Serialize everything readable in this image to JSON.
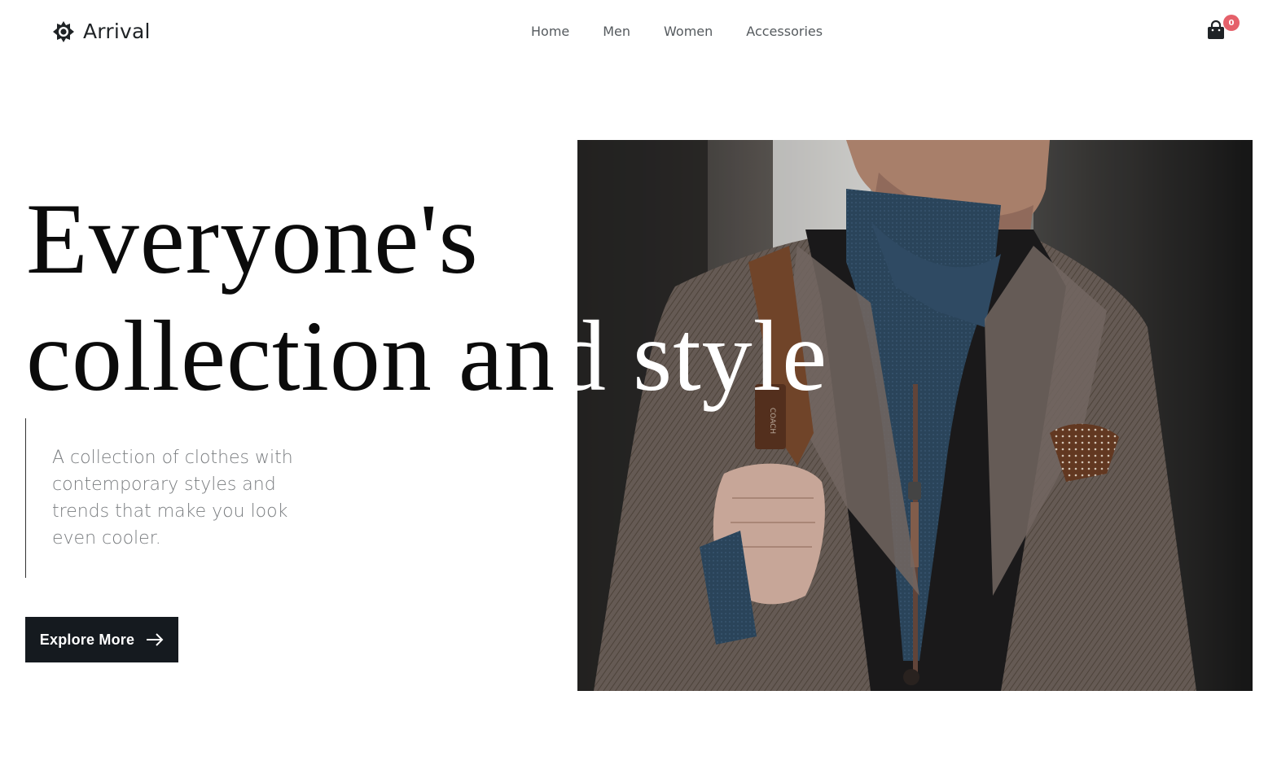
{
  "brand": {
    "name": "Arrival",
    "icon": "gear-sun-icon"
  },
  "nav": {
    "items": [
      {
        "label": "Home"
      },
      {
        "label": "Men"
      },
      {
        "label": "Women"
      },
      {
        "label": "Accessories"
      }
    ]
  },
  "cart": {
    "icon": "shopping-bag-icon",
    "count": "0",
    "badge_color": "#e5606a"
  },
  "hero": {
    "headline_line1": "Everyone's",
    "headline_line2_dark": "collection an",
    "headline_line2_light": "d style",
    "description": "A collection of clothes with contemporary styles and trends that make you look even cooler.",
    "button_label": "Explore More",
    "button_icon": "arrow-right-icon",
    "image_subject": "man-in-tweed-jacket-photo"
  },
  "colors": {
    "button_bg": "#151a1f",
    "text_dark": "#0b0b0b",
    "text_muted": "#7a7d80"
  }
}
